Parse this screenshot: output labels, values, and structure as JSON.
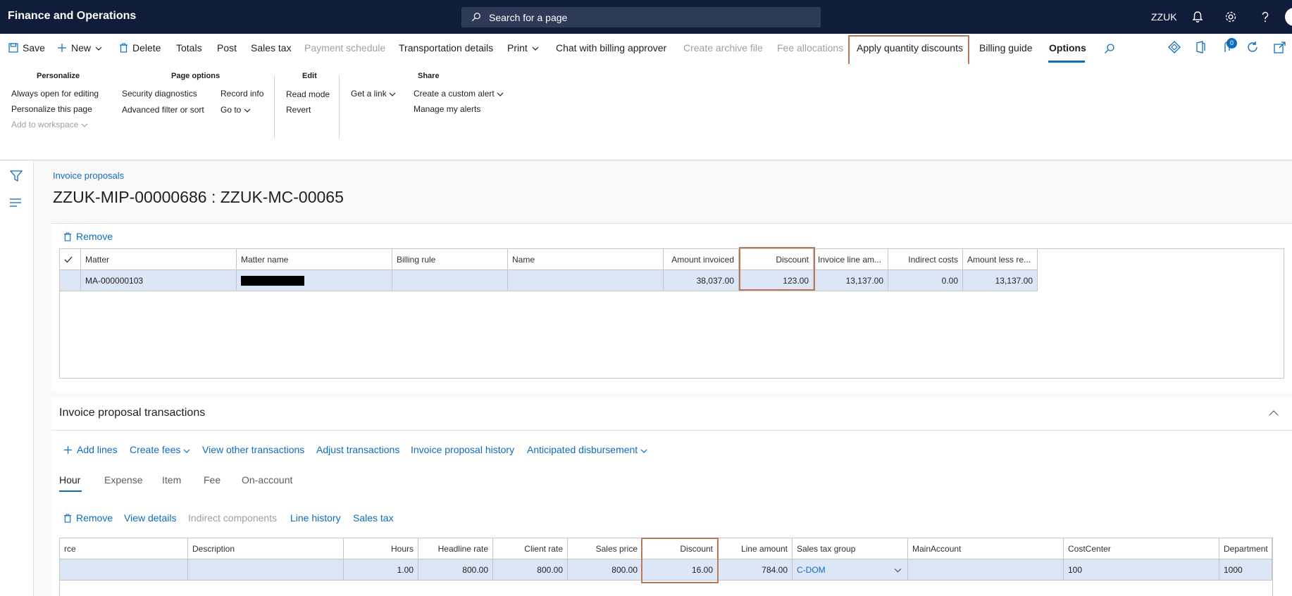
{
  "topbar": {
    "app_title": "Finance and Operations",
    "search_placeholder": "Search for a page",
    "company": "ZZUK"
  },
  "actions": {
    "save": "Save",
    "new": "New",
    "delete": "Delete",
    "totals": "Totals",
    "post": "Post",
    "sales_tax": "Sales tax",
    "payment_schedule": "Payment schedule",
    "transportation_details": "Transportation details",
    "print": "Print",
    "chat": "Chat with billing approver",
    "create_archive": "Create archive file",
    "fee_allocations": "Fee allocations",
    "apply_qty_discounts": "Apply quantity discounts",
    "billing_guide": "Billing guide",
    "options": "Options",
    "notification_count": "0"
  },
  "ribbon": {
    "personalize": {
      "title": "Personalize",
      "items": [
        "Always open for editing",
        "Personalize this page",
        "Add to workspace"
      ]
    },
    "page_options": {
      "title": "Page options",
      "items": [
        "Security diagnostics",
        "Advanced filter or sort",
        "Record info",
        "Go to"
      ]
    },
    "edit": {
      "title": "Edit",
      "items": [
        "Read mode",
        "Revert"
      ]
    },
    "share": {
      "title": "Share",
      "items": [
        "Get a link",
        "Create a custom alert",
        "Manage my alerts"
      ]
    }
  },
  "breadcrumb": "Invoice proposals",
  "page_title": "ZZUK-MIP-00000686 : ZZUK-MC-00065",
  "matters": {
    "remove": "Remove",
    "columns": [
      "Matter",
      "Matter name",
      "Billing rule",
      "Name",
      "Amount invoiced",
      "Discount",
      "Invoice line am...",
      "Indirect costs",
      "Amount less re..."
    ],
    "rows": [
      {
        "matter": "MA-000000103",
        "matter_name": "",
        "billing_rule": "",
        "name": "",
        "amount_invoiced": "38,037.00",
        "discount": "123.00",
        "invoice_line_amount": "13,137.00",
        "indirect_costs": "0.00",
        "amount_less": "13,137.00"
      }
    ]
  },
  "transactions": {
    "title": "Invoice proposal transactions",
    "actions": [
      "Add lines",
      "Create fees",
      "View other transactions",
      "Adjust transactions",
      "Invoice proposal history",
      "Anticipated disbursement"
    ],
    "tabs": [
      "Hour",
      "Expense",
      "Item",
      "Fee",
      "On-account"
    ],
    "line_actions": [
      "Remove",
      "View details",
      "Indirect components",
      "Line history",
      "Sales tax"
    ],
    "columns": [
      "rce",
      "Description",
      "Hours",
      "Headline rate",
      "Client rate",
      "Sales price",
      "Discount",
      "Line amount",
      "Sales tax group",
      "MainAccount",
      "CostCenter",
      "Department"
    ],
    "rows": [
      {
        "resource": "",
        "description": "",
        "hours": "1.00",
        "headline_rate": "800.00",
        "client_rate": "800.00",
        "sales_price": "800.00",
        "discount": "16.00",
        "line_amount": "784.00",
        "sales_tax_group": "C-DOM",
        "main_account": "",
        "cost_center": "100",
        "department": "1000"
      }
    ]
  },
  "colors": {
    "topbar": "#0f1c3a",
    "highlight_box": "#b87a5a",
    "accent": "#0f6cbd",
    "selected_row": "#dde6f7"
  }
}
